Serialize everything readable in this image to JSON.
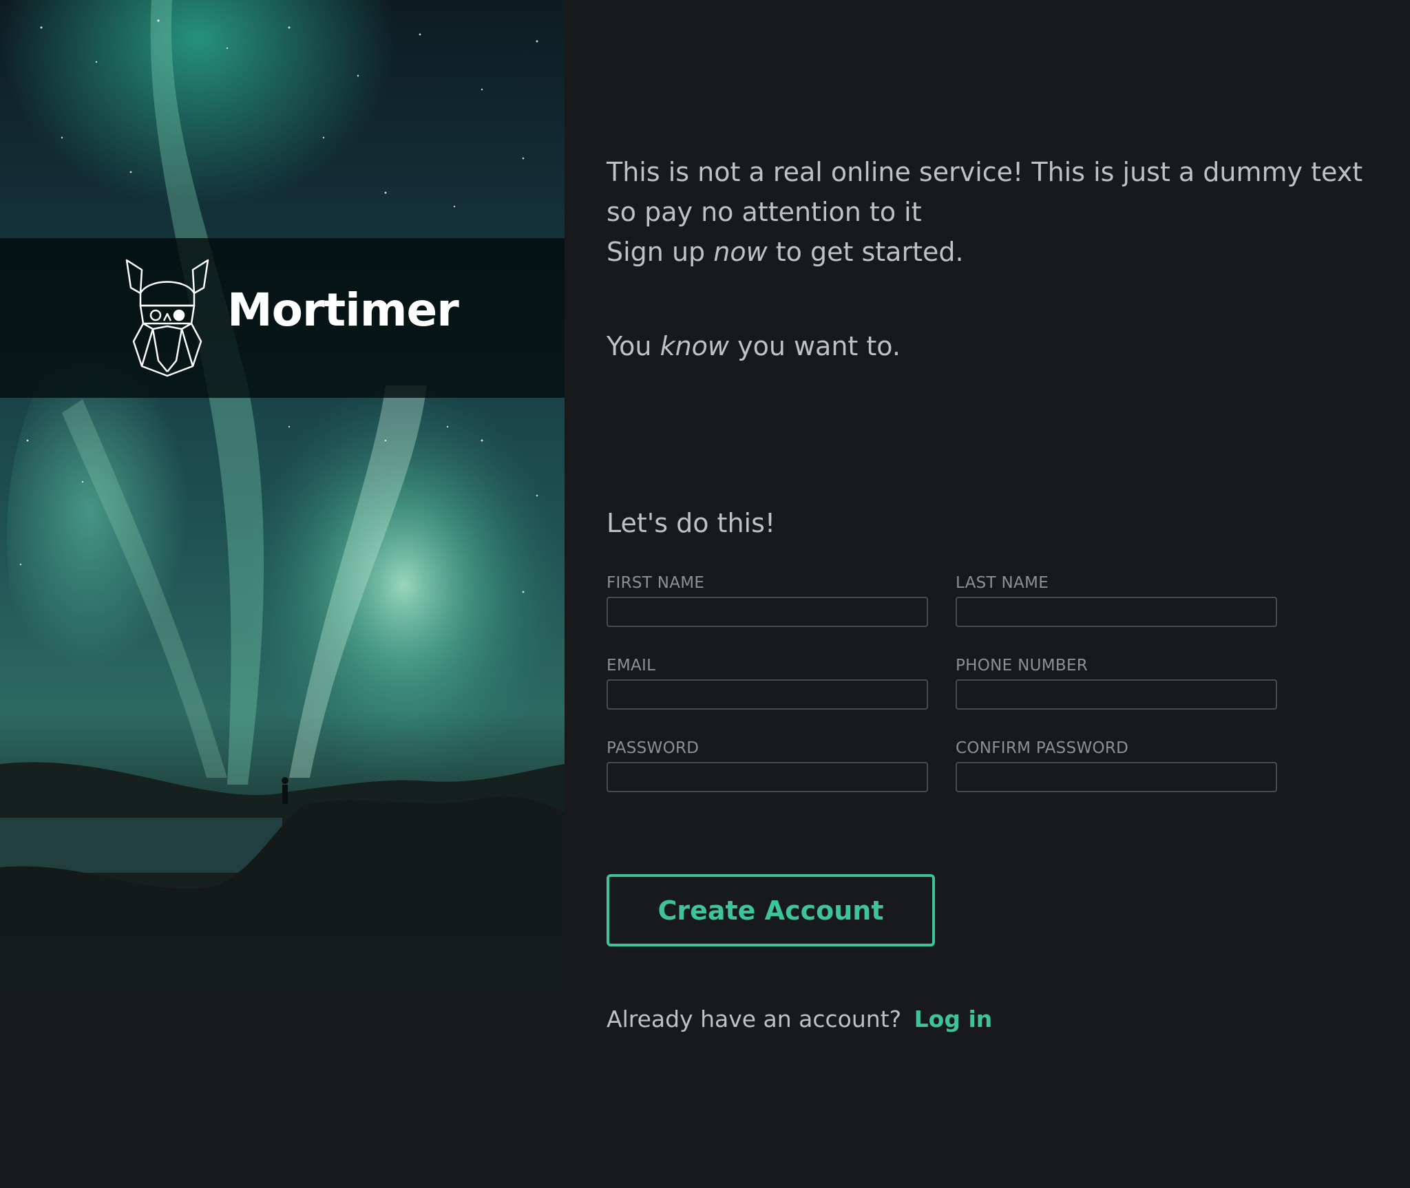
{
  "hero": {
    "brand_name": "Mortimer",
    "logo_icon": "viking-head-logo-icon"
  },
  "intro": {
    "line1": "This is not a real online service! This is just a dummy text so pay no attention to it",
    "line2_before": "Sign up ",
    "line2_emphasis": "now",
    "line2_after": " to get started.",
    "tagline_before": "You ",
    "tagline_emphasis": "know",
    "tagline_after": " you want to."
  },
  "form": {
    "heading": "Let's do this!",
    "fields": {
      "first_name": {
        "label": "FIRST NAME",
        "value": ""
      },
      "last_name": {
        "label": "LAST NAME",
        "value": ""
      },
      "email": {
        "label": "EMAIL",
        "value": ""
      },
      "phone": {
        "label": "PHONE NUMBER",
        "value": ""
      },
      "password": {
        "label": "PASSWORD",
        "value": ""
      },
      "confirm_password": {
        "label": "CONFIRM PASSWORD",
        "value": ""
      }
    },
    "submit_label": "Create Account"
  },
  "login": {
    "prompt": "Already have an account?",
    "link_label": "Log in"
  },
  "colors": {
    "background": "#18191b",
    "accent": "#3fc39d",
    "text": "#bfc1c3",
    "label": "#8d9094",
    "input_border": "#4a4c50"
  }
}
